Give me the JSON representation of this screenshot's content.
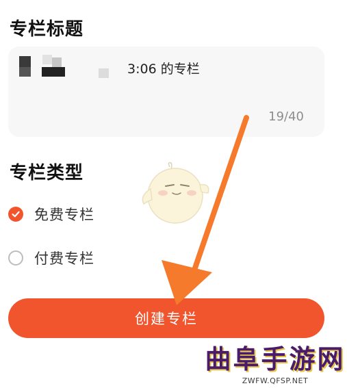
{
  "form": {
    "title_section_label": "专栏标题",
    "title_value": "3:06 的专栏",
    "title_counter": "19/40",
    "type_section_label": "专栏类型",
    "options": [
      {
        "label": "免费专栏",
        "checked": true
      },
      {
        "label": "付费专栏",
        "checked": false
      }
    ],
    "create_button_label": "创建专栏"
  },
  "colors": {
    "accent": "#f1552e",
    "arrow": "#f57a2c"
  },
  "watermark": {
    "text": "曲阜手游网",
    "url": "ZWFW.QFSP.NET"
  }
}
